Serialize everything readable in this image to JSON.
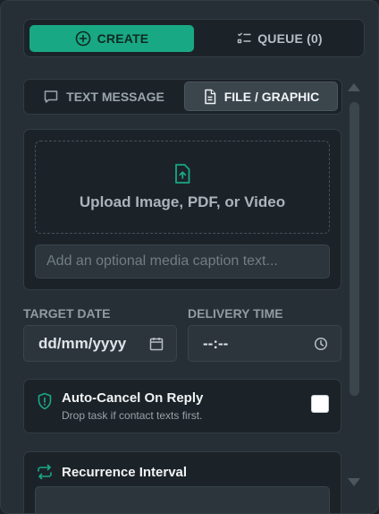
{
  "tabs": {
    "create_label": "CREATE",
    "queue_label": "QUEUE (0)"
  },
  "mode": {
    "text_label": "TEXT MESSAGE",
    "file_label": "FILE / GRAPHIC",
    "selected": "FILE / GRAPHIC"
  },
  "media": {
    "upload_label": "Upload Image, PDF, or Video",
    "caption_placeholder": "Add an optional media caption text...",
    "caption_value": ""
  },
  "schedule": {
    "date_label": "TARGET DATE",
    "date_value": "dd/mm/yyyy",
    "time_label": "DELIVERY TIME",
    "time_value": "--:--"
  },
  "auto_cancel": {
    "title": "Auto-Cancel On Reply",
    "subtitle": "Drop task if contact texts first.",
    "checked": false
  },
  "recurrence": {
    "title": "Recurrence Interval"
  },
  "colors": {
    "accent": "#19a884",
    "panel": "#262f35",
    "card": "#1c2328"
  },
  "icons": {
    "create": "plus-circle-icon",
    "queue": "checklist-icon",
    "text": "message-icon",
    "file": "document-icon",
    "upload": "file-upload-icon",
    "date": "calendar-icon",
    "time": "clock-icon",
    "auto_cancel": "shield-alert-icon",
    "recurrence": "repeat-icon"
  }
}
